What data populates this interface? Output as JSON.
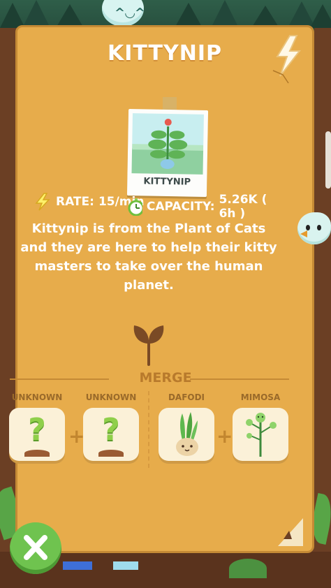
{
  "card": {
    "title": "KITTYNIP",
    "polaroid_label": "KITTYNIP",
    "stats": {
      "rate_label": "RATE:",
      "rate_value": "15/min",
      "capacity_label": "CAPACITY:",
      "capacity_value": "5.26K ( 6h )"
    },
    "description": "Kittynip is from the Plant of Cats and they are here to help their kitty masters to take over the human planet."
  },
  "merge": {
    "title": "MERGE",
    "slots": [
      {
        "label": "UNKNOWN",
        "icon": "question-plant-icon"
      },
      {
        "label": "UNKNOWN",
        "icon": "question-plant-icon"
      },
      {
        "label": "DAFODI",
        "icon": "dafodi-plant-icon"
      },
      {
        "label": "MIMOSA",
        "icon": "mimosa-plant-icon"
      }
    ],
    "plus_symbol": "+"
  },
  "icons": {
    "close": "close-icon",
    "rate": "lightning-icon",
    "capacity": "stopwatch-icon",
    "sprout": "sprout-icon"
  },
  "colors": {
    "card_bg": "#e7ac4b",
    "close_button": "#6fc34f",
    "merge_text": "#b87a2c"
  }
}
